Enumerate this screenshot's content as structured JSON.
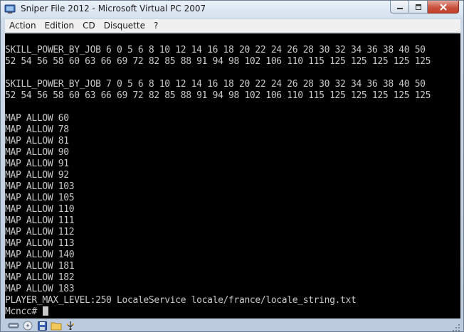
{
  "window": {
    "title": "Sniper File 2012 - Microsoft Virtual PC 2007"
  },
  "menu": [
    {
      "label": "Action"
    },
    {
      "label": "Edition"
    },
    {
      "label": "CD"
    },
    {
      "label": "Disquette"
    },
    {
      "label": "?"
    }
  ],
  "console": {
    "lines": [
      "",
      "SKILL_POWER_BY_JOB 6 0 5 6 8 10 12 14 16 18 20 22 24 26 28 30 32 34 36 38 40 50",
      "52 54 56 58 60 63 66 69 72 82 85 88 91 94 98 102 106 110 115 125 125 125 125 125",
      "",
      "SKILL_POWER_BY_JOB 7 0 5 6 8 10 12 14 16 18 20 22 24 26 28 30 32 34 36 38 40 50",
      "52 54 56 58 60 63 66 69 72 82 85 88 91 94 98 102 106 110 115 125 125 125 125 125",
      "",
      "MAP ALLOW 60",
      "MAP ALLOW 78",
      "MAP ALLOW 81",
      "MAP ALLOW 90",
      "MAP ALLOW 91",
      "MAP ALLOW 92",
      "MAP ALLOW 103",
      "MAP ALLOW 105",
      "MAP ALLOW 110",
      "MAP ALLOW 111",
      "MAP ALLOW 112",
      "MAP ALLOW 113",
      "MAP ALLOW 140",
      "MAP ALLOW 181",
      "MAP ALLOW 182",
      "MAP ALLOW 183",
      "PLAYER_MAX_LEVEL:250 LocaleService locale/france/locale_string.txt"
    ],
    "prompt": "Mcncc# "
  },
  "status_icons": [
    "network-icon",
    "cd-icon",
    "floppy-icon",
    "shared-folder-icon",
    "usb-icon"
  ],
  "colors": {
    "console_bg": "#000000",
    "console_fg": "#c8c8c8",
    "close_button": "#c7523d",
    "chrome": "#cfdbe9"
  }
}
